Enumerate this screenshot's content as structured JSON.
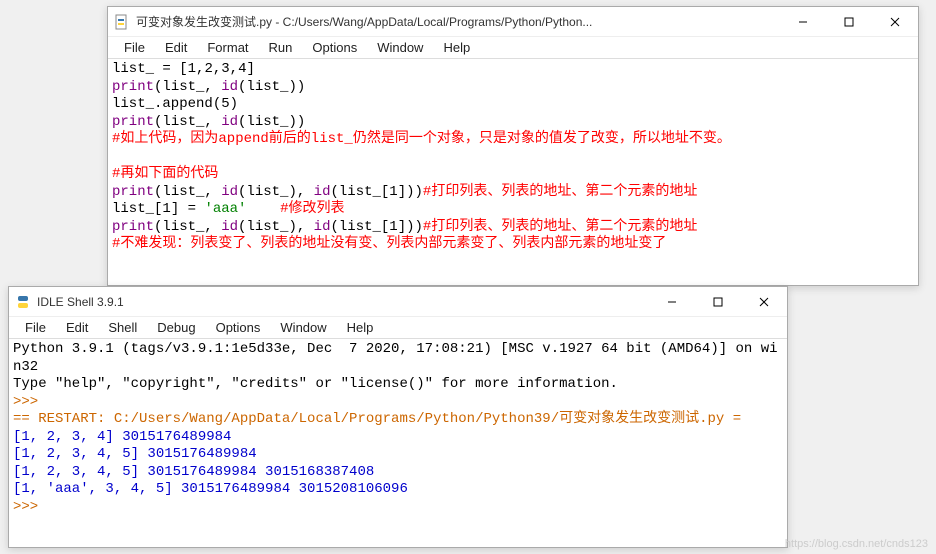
{
  "editor": {
    "title": "可变对象发生改变测试.py - C:/Users/Wang/AppData/Local/Programs/Python/Python...",
    "menu": [
      "File",
      "Edit",
      "Format",
      "Run",
      "Options",
      "Window",
      "Help"
    ],
    "code": {
      "l1a": "list_ = [",
      "l1b": "1",
      "l1c": ",",
      "l1d": "2",
      "l1e": ",",
      "l1f": "3",
      "l1g": ",",
      "l1h": "4",
      "l1i": "]",
      "l2a": "print",
      "l2b": "(list_, ",
      "l2c": "id",
      "l2d": "(list_))",
      "l3a": "list_.append(",
      "l3b": "5",
      "l3c": ")",
      "l4a": "print",
      "l4b": "(list_, ",
      "l4c": "id",
      "l4d": "(list_))",
      "l5": "#如上代码，因为append前后的list_仍然是同一个对象，只是对象的值发了改变，所以地址不变。",
      "blank": " ",
      "l6": "#再如下面的代码",
      "l7a": "print",
      "l7b": "(list_, ",
      "l7c": "id",
      "l7d": "(list_), ",
      "l7e": "id",
      "l7f": "(list_[",
      "l7g": "1",
      "l7h": "]))",
      "l7i": "#打印列表、列表的地址、第二个元素的地址",
      "l8a": "list_[",
      "l8b": "1",
      "l8c": "] = ",
      "l8d": "'aaa'",
      "l8e": "    ",
      "l8f": "#修改列表",
      "l9a": "print",
      "l9b": "(list_, ",
      "l9c": "id",
      "l9d": "(list_), ",
      "l9e": "id",
      "l9f": "(list_[",
      "l9g": "1",
      "l9h": "]))",
      "l9i": "#打印列表、列表的地址、第二个元素的地址",
      "l10": "#不难发现：列表变了、列表的地址没有变、列表内部元素变了、列表内部元素的地址变了"
    }
  },
  "shell": {
    "title": "IDLE Shell 3.9.1",
    "menu": [
      "File",
      "Edit",
      "Shell",
      "Debug",
      "Options",
      "Window",
      "Help"
    ],
    "out": {
      "l1": "Python 3.9.1 (tags/v3.9.1:1e5d33e, Dec  7 2020, 17:08:21) [MSC v.1927 64 bit (AMD64)] on win32",
      "l2": "Type \"help\", \"copyright\", \"credits\" or \"license()\" for more information.",
      "p1": ">>>",
      "l3": "== RESTART: C:/Users/Wang/AppData/Local/Programs/Python/Python39/可变对象发生改变测试.py =",
      "l4": "[1, 2, 3, 4] 3015176489984",
      "l5": "[1, 2, 3, 4, 5] 3015176489984",
      "l6": "[1, 2, 3, 4, 5] 3015176489984 3015168387408",
      "l7": "[1, 'aaa', 3, 4, 5] 3015176489984 3015208106096",
      "p2": ">>>"
    }
  },
  "watermark": "https://blog.csdn.net/cnds123"
}
